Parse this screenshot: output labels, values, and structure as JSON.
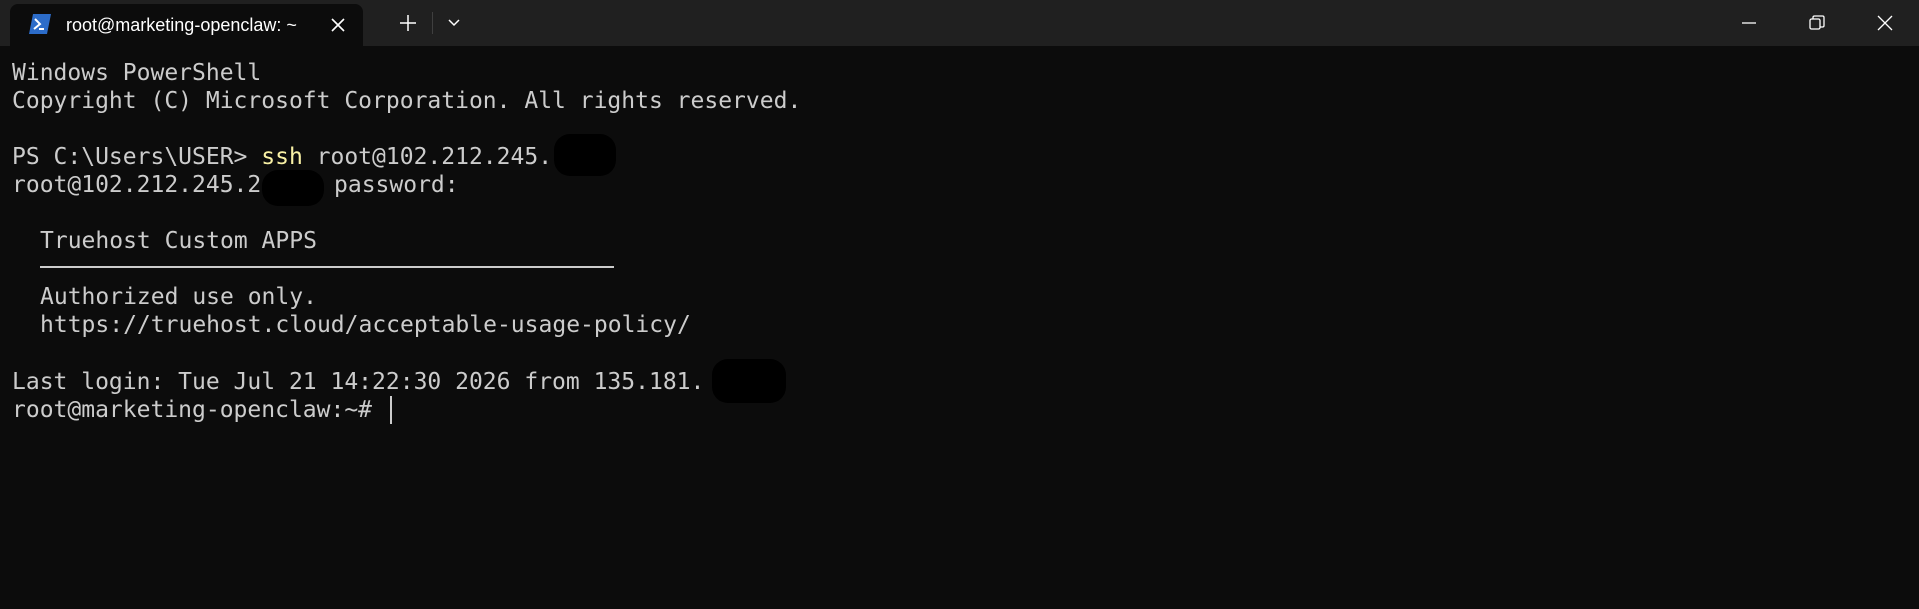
{
  "window": {
    "tab_title": "root@marketing-openclaw: ~",
    "tab_icon": "powershell-icon",
    "new_tab_icon": "plus-icon",
    "dropdown_icon": "chevron-down-icon",
    "minimize_icon": "minimize-icon",
    "restore_icon": "restore-icon",
    "close_icon": "close-icon",
    "colors": {
      "titlebar_bg": "#202020",
      "terminal_bg": "#0c0c0c",
      "text": "#cccccc",
      "command_highlight": "#f9f1a5",
      "powershell_blue": "#2c6cc9"
    }
  },
  "terminal": {
    "header_line1": "Windows PowerShell",
    "header_line2": "Copyright (C) Microsoft Corporation. All rights reserved.",
    "prompt_prefix": "PS C:\\Users\\USER> ",
    "command": "ssh",
    "command_args": " root@102.212.245.",
    "password_host": "root@102.212.245.2",
    "password_label": "password:",
    "banner_title": "Truehost Custom APPS",
    "banner_line1": "Authorized use only.",
    "banner_line2": "https://truehost.cloud/acceptable-usage-policy/",
    "last_login": "Last login: Tue Jul 21 14:22:30 2026 from 135.181.",
    "shell_prompt": "root@marketing-openclaw:~#"
  }
}
